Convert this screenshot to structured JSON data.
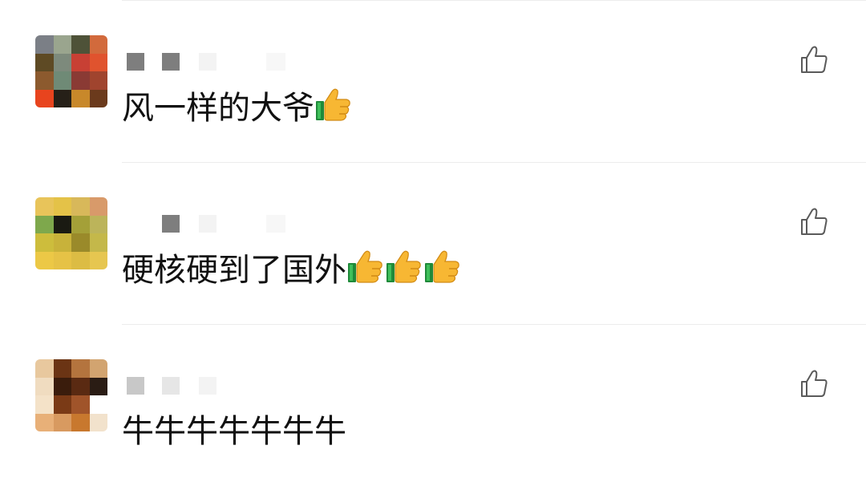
{
  "comments": [
    {
      "text": "风一样的大爷",
      "emoji": [
        "thumbs-up-emoji"
      ],
      "like_icon": "thumbs-up-outline-icon",
      "avatar": [
        "#7b7f86",
        "#9aa58e",
        "#4e5238",
        "#d26a3c",
        "#5e4a24",
        "#7d8a7c",
        "#c84034",
        "#e0532e",
        "#8c5a2e",
        "#6f8a76",
        "#8a3a34",
        "#a0442e",
        "#e8441e",
        "#262018",
        "#c8882a",
        "#6b3a1c"
      ],
      "name_blocks": [
        "#7e7e7e",
        "#7e7e7e",
        "#f3f3f3",
        "#f7f7f7"
      ]
    },
    {
      "text": "硬核硬到了国外",
      "emoji": [
        "thumbs-up-emoji",
        "thumbs-up-emoji",
        "thumbs-up-emoji"
      ],
      "like_icon": "thumbs-up-outline-icon",
      "avatar": [
        "#e8c45a",
        "#e4c248",
        "#d8b85a",
        "#d89a6a",
        "#7ea84c",
        "#1a1a12",
        "#a4a038",
        "#bcb45a",
        "#cdbd3c",
        "#c8b23a",
        "#9a8a2a",
        "#c4b84a",
        "#ecc846",
        "#e6c246",
        "#dcbc44",
        "#e6c650"
      ],
      "name_blocks": [
        "#ffffff",
        "#7e7e7e",
        "#f3f3f3",
        "#f7f7f7"
      ]
    },
    {
      "text": "牛牛牛牛牛牛牛",
      "emoji": [],
      "like_icon": "thumbs-up-outline-icon",
      "avatar": [
        "#e8c89e",
        "#6b3414",
        "#b4743e",
        "#d2a470",
        "#f0dcc0",
        "#3a1c0c",
        "#5a2a12",
        "#2a1c14",
        "#f4e2c8",
        "#7a3a16",
        "#a0542a",
        "#ffffff",
        "#e8b078",
        "#d89a60",
        "#c8782e",
        "#f2e2cc"
      ],
      "name_blocks": [
        "#c8c8c8",
        "#e6e6e6",
        "#f3f3f3",
        "#ffffff"
      ]
    }
  ]
}
